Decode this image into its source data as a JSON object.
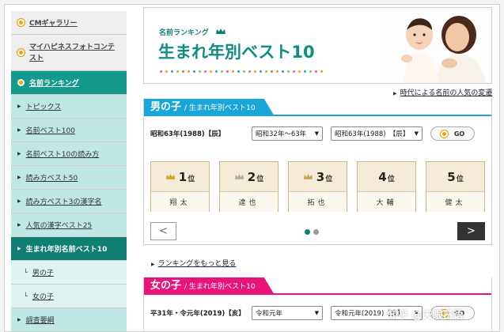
{
  "sidebar": {
    "items": [
      {
        "label": "CMギャラリー"
      },
      {
        "label": "マイハピネスフォトコンテスト"
      },
      {
        "label": "名前ランキング"
      },
      {
        "label": "トピックス"
      },
      {
        "label": "名前ベスト100"
      },
      {
        "label": "名前ベスト10の読み方"
      },
      {
        "label": "読み方ベスト50"
      },
      {
        "label": "読み方ベスト3の漢字名"
      },
      {
        "label": "人気の漢字ベスト25"
      },
      {
        "label": "生まれ年別名前ベスト10"
      },
      {
        "label": "男の子"
      },
      {
        "label": "女の子"
      },
      {
        "label": "調査要綱"
      }
    ]
  },
  "banner": {
    "subtitle": "名前ランキング",
    "title": "生まれ年別ベスト10"
  },
  "links": {
    "era": "時代による名前の人気の変遷",
    "more_ranking": "ランキングをもっと見る"
  },
  "boy": {
    "title": "男の子",
    "subtitle": "/ 生まれ年別ベスト10",
    "year_label": "昭和63年(1988)【辰】",
    "era_select": "昭和32年～63年",
    "year_select": "昭和63年(1988)　【辰】",
    "go_label": "GO",
    "ranks": [
      {
        "num": "1",
        "pos": "位",
        "name": "翔太"
      },
      {
        "num": "2",
        "pos": "位",
        "name": "達也"
      },
      {
        "num": "3",
        "pos": "位",
        "name": "拓也"
      },
      {
        "num": "4",
        "pos": "位",
        "name": "大輔"
      },
      {
        "num": "5",
        "pos": "位",
        "name": "健太"
      }
    ]
  },
  "girl": {
    "title": "女の子",
    "subtitle": "/ 生まれ年別ベスト10",
    "year_label": "平31年・令元年(2019)【亥】",
    "era_select": "令和元年",
    "year_select": "令和元年(2019)【亥】",
    "go_label": "GO"
  },
  "watermark": {
    "text": "知乎 @天眼日语"
  },
  "colors": {
    "teal": "#149a8c",
    "boy_blue": "#1aa6d9",
    "girl_pink": "#e8147a",
    "gold": "#f5a300"
  }
}
